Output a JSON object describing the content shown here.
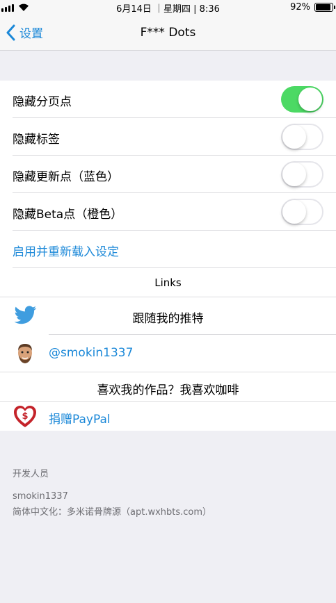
{
  "status_bar": {
    "time": "6月14日 ｜星期四 | 8:36",
    "battery": "92%",
    "battery_level": 0.92
  },
  "nav": {
    "back_label": "设置",
    "title": "F*** Dots"
  },
  "settings": {
    "hide_page_dots": {
      "label": "隐藏分页点",
      "on": true
    },
    "hide_labels": {
      "label": "隐藏标签",
      "on": false
    },
    "hide_update_dots": {
      "label": "隐藏更新点（蓝色）",
      "on": false
    },
    "hide_beta_dots": {
      "label": "隐藏Beta点（橙色）",
      "on": false
    },
    "respring": "启用并重新载入设定"
  },
  "links": {
    "header": "Links",
    "follow_twitter": "跟随我的推特",
    "twitter_handle": "@smokin1337",
    "coffee": "喜欢我的作品？我喜欢咖啡",
    "donate": "捐赠PayPal"
  },
  "footer": {
    "developer_header": "开发人员",
    "developer_name": "smokin1337",
    "localization": "简体中文化：多米诺骨牌源（apt.wxhbts.com）"
  },
  "colors": {
    "accent": "#1b88d8",
    "toggle_on": "#4cd964",
    "background": "#efeff4"
  }
}
